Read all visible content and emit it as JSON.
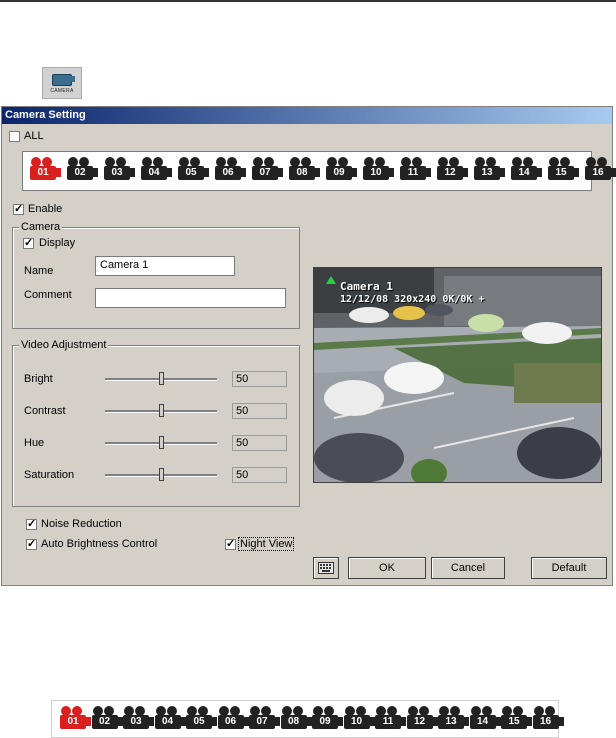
{
  "toolbar_icon": {
    "label": "CAMERA",
    "icon": "camera-icon"
  },
  "window": {
    "title": "Camera Setting",
    "all_label": "ALL",
    "all_checked": false,
    "cameras": [
      "01",
      "02",
      "03",
      "04",
      "05",
      "06",
      "07",
      "08",
      "09",
      "10",
      "11",
      "12",
      "13",
      "14",
      "15",
      "16"
    ],
    "selected_camera": "01",
    "enable_label": "Enable",
    "enable_checked": true,
    "camera_group": {
      "title": "Camera",
      "display_label": "Display",
      "display_checked": true,
      "name_label": "Name",
      "name_value": "Camera 1",
      "comment_label": "Comment",
      "comment_value": ""
    },
    "video_group": {
      "title": "Video Adjustment",
      "items": [
        {
          "label": "Bright",
          "value": "50",
          "fraction": 0.5
        },
        {
          "label": "Contrast",
          "value": "50",
          "fraction": 0.5
        },
        {
          "label": "Hue",
          "value": "50",
          "fraction": 0.5
        },
        {
          "label": "Saturation",
          "value": "50",
          "fraction": 0.5
        }
      ]
    },
    "noise_reduction_label": "Noise Reduction",
    "noise_reduction_checked": true,
    "auto_brightness_label": "Auto Brightness Control",
    "auto_brightness_checked": true,
    "night_view_label": "Night View",
    "night_view_checked": true,
    "preview": {
      "overlay_name": "Camera 1",
      "overlay_info": "12/12/08 320x240 0K/0K +"
    },
    "buttons": {
      "keyboard_icon": "keyboard-icon",
      "ok": "OK",
      "cancel": "Cancel",
      "default": "Default"
    }
  },
  "colors": {
    "title_start": "#0a246a",
    "title_end": "#a6caf0",
    "selected_camera": "#d9201e",
    "window_bg": "#d4d0c8"
  },
  "bottom_strip": {
    "cameras": [
      "01",
      "02",
      "03",
      "04",
      "05",
      "06",
      "07",
      "08",
      "09",
      "10",
      "11",
      "12",
      "13",
      "14",
      "15",
      "16"
    ],
    "selected_camera": "01"
  }
}
